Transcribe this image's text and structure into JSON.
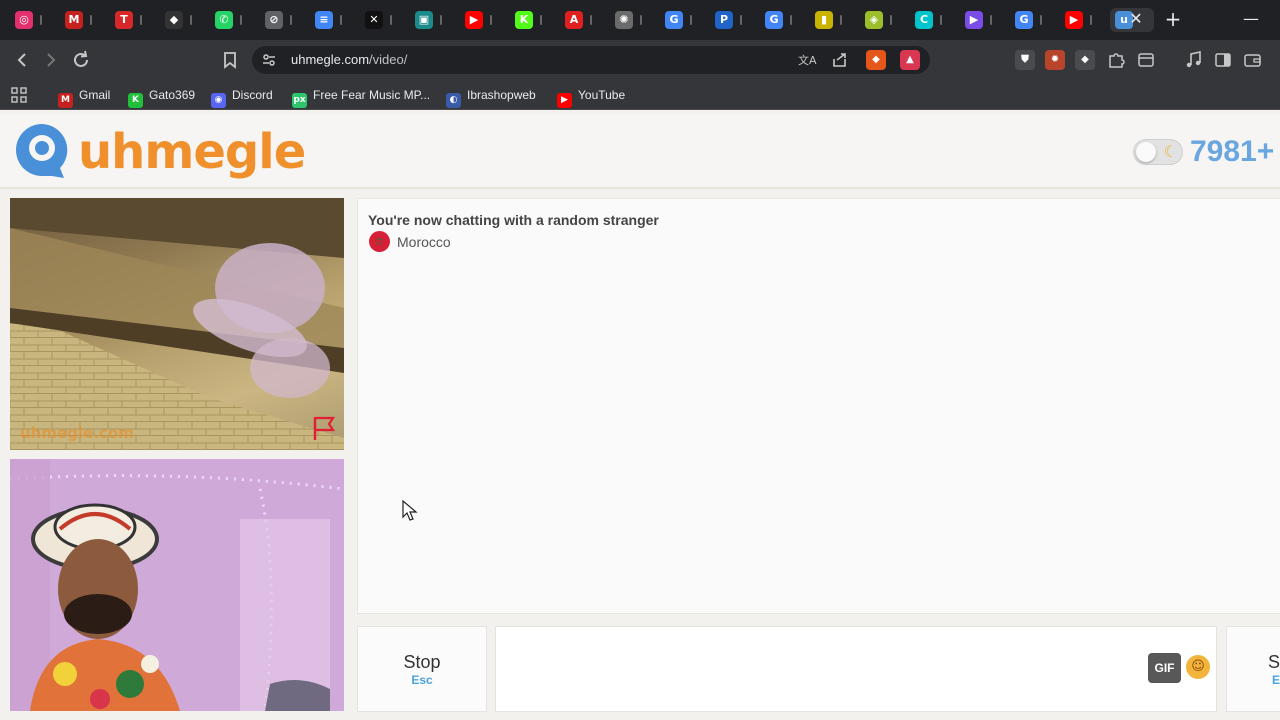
{
  "browser": {
    "address": {
      "host": "uhmegle.com",
      "path": "/video/"
    },
    "tab_close": "✕",
    "new_tab": "+",
    "minimize": "—",
    "tabs": [
      {
        "icon": "instagram-icon",
        "color": "#e1306c",
        "glyph": "◎"
      },
      {
        "icon": "gmail-icon",
        "color": "#c5221f",
        "glyph": "M"
      },
      {
        "icon": "red-app-icon",
        "color": "#d62828",
        "glyph": "T"
      },
      {
        "icon": "diamond-icon",
        "color": "#333333",
        "glyph": "◆"
      },
      {
        "icon": "whatsapp-icon",
        "color": "#25d366",
        "glyph": "✆"
      },
      {
        "icon": "chrome-icon",
        "color": "#5f6368",
        "glyph": "⊘"
      },
      {
        "icon": "docs-icon",
        "color": "#4285f4",
        "glyph": "≡"
      },
      {
        "icon": "x-icon",
        "color": "#111111",
        "glyph": "✕"
      },
      {
        "icon": "teal-app-icon",
        "color": "#1b8a8a",
        "glyph": "▣"
      },
      {
        "icon": "youtube-icon",
        "color": "#ff0000",
        "glyph": "▶"
      },
      {
        "icon": "kick-icon",
        "color": "#53fc18",
        "glyph": "K"
      },
      {
        "icon": "acrobat-icon",
        "color": "#e02020",
        "glyph": "A"
      },
      {
        "icon": "openai-icon",
        "color": "#6b6b6b",
        "glyph": "✺"
      },
      {
        "icon": "google-icon",
        "color": "#4285f4",
        "glyph": "G"
      },
      {
        "icon": "paypal-icon",
        "color": "#1f64c6",
        "glyph": "P"
      },
      {
        "icon": "google-icon",
        "color": "#4285f4",
        "glyph": "G"
      },
      {
        "icon": "yellow-app-icon",
        "color": "#c8b400",
        "glyph": "▮"
      },
      {
        "icon": "green-cube-icon",
        "color": "#9bbf2a",
        "glyph": "◈"
      },
      {
        "icon": "canva-icon",
        "color": "#00c4cc",
        "glyph": "C"
      },
      {
        "icon": "video-app-icon",
        "color": "#7b4de8",
        "glyph": "▶"
      },
      {
        "icon": "google-icon",
        "color": "#4285f4",
        "glyph": "G"
      },
      {
        "icon": "youtube-icon",
        "color": "#ff0000",
        "glyph": "▶"
      },
      {
        "icon": "uhmegle-icon",
        "color": "#4a90d9",
        "glyph": "u"
      }
    ],
    "bookmarks": [
      {
        "label": "Gmail",
        "icon": "gmail-icon",
        "color": "#c5221f",
        "glyph": "M"
      },
      {
        "label": "Gato369",
        "icon": "kick-icon",
        "color": "#1fbf3a",
        "glyph": "K"
      },
      {
        "label": "Discord",
        "icon": "discord-icon",
        "color": "#5865f2",
        "glyph": "◉"
      },
      {
        "label": "Free Fear Music MP...",
        "icon": "pixabay-icon",
        "color": "#2ec66d",
        "glyph": "px"
      },
      {
        "label": "Ibrashopweb",
        "icon": "ibrashop-icon",
        "color": "#3a5ba8",
        "glyph": "◐"
      },
      {
        "label": "YouTube",
        "icon": "youtube-icon",
        "color": "#ff0000",
        "glyph": "▶"
      }
    ]
  },
  "site": {
    "logo_text": "uhmegle",
    "online_count": "7981+",
    "watermark": "uhmegle.com"
  },
  "chat": {
    "status": "You're now chatting with a random stranger",
    "country": "Morocco",
    "country_flag_glyph": "✩",
    "message_value": ""
  },
  "controls": {
    "stop_label": "Stop",
    "stop_key": "Esc",
    "gif_label": "GIF",
    "emoji_glyph": "☺",
    "send_label": "S",
    "send_key": "E"
  }
}
